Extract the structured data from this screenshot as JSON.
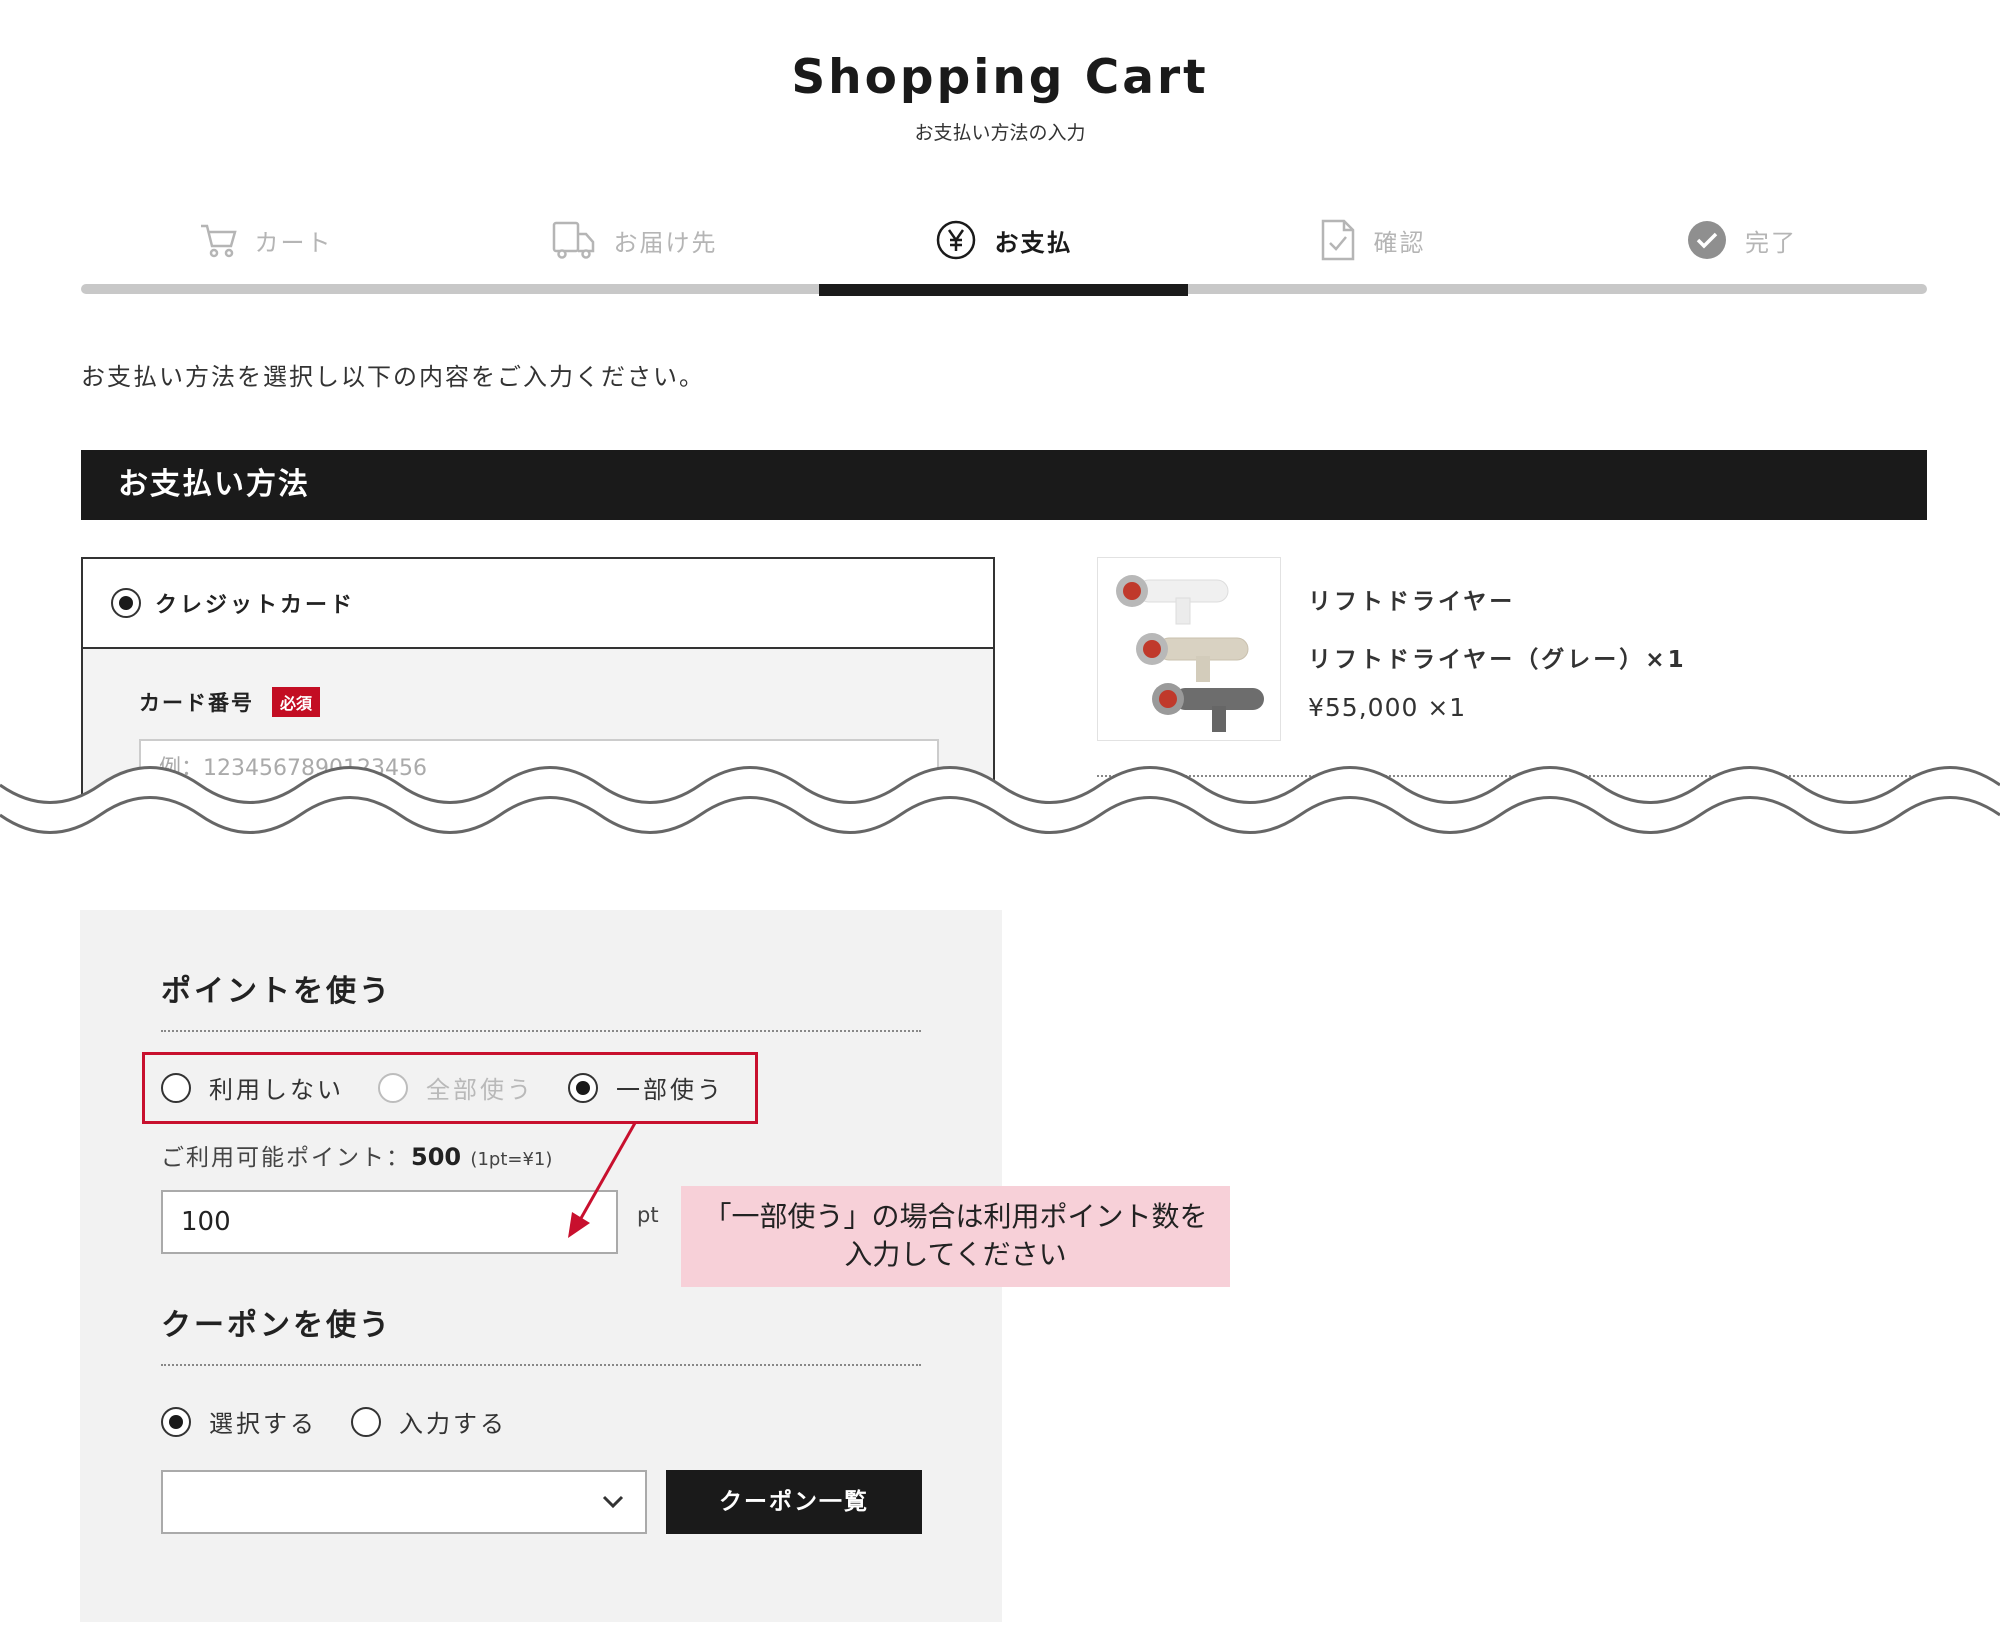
{
  "header": {
    "title": "Shopping Cart",
    "subtitle": "お支払い方法の入力"
  },
  "steps": [
    {
      "label": "カート",
      "icon": "cart-icon",
      "state": "done"
    },
    {
      "label": "お届け先",
      "icon": "truck-icon",
      "state": "done"
    },
    {
      "label": "お支払",
      "icon": "yen-icon",
      "state": "active"
    },
    {
      "label": "確認",
      "icon": "document-check-icon",
      "state": "upcoming"
    },
    {
      "label": "完了",
      "icon": "check-circle-icon",
      "state": "upcoming"
    }
  ],
  "intro_text": "お支払い方法を選択し以下の内容をご入力ください。",
  "payment_section": {
    "heading": "お支払い方法",
    "option_label": "クレジットカード",
    "card_number_label": "カード番号",
    "required_badge": "必須",
    "card_number_placeholder": "例：1234567890123456"
  },
  "product": {
    "name": "リフトドライヤー",
    "variant": "リフトドライヤー（グレー）×1",
    "price": "¥55,000 ×1"
  },
  "points": {
    "heading": "ポイントを使う",
    "options": [
      {
        "label": "利用しない",
        "checked": false,
        "disabled": false
      },
      {
        "label": "全部使う",
        "checked": false,
        "disabled": true
      },
      {
        "label": "一部使う",
        "checked": true,
        "disabled": false
      }
    ],
    "available_label": "ご利用可能ポイント：",
    "available_value": "500",
    "rate": "(1pt=¥1)",
    "input_value": "100",
    "unit": "pt"
  },
  "coupon": {
    "heading": "クーポンを使う",
    "options": [
      {
        "label": "選択する",
        "checked": true
      },
      {
        "label": "入力する",
        "checked": false
      }
    ],
    "select_value": "",
    "list_button": "クーポン一覧"
  },
  "annotation": {
    "line1": "「一部使う」の場合は利用ポイント数を",
    "line2": "入力してください"
  },
  "colors": {
    "dark": "#1a1a1a",
    "required_red": "#c30d23",
    "highlight_red": "#c8102e",
    "callout_pink": "#f7d0d8",
    "panel_gray": "#f2f2f2"
  }
}
